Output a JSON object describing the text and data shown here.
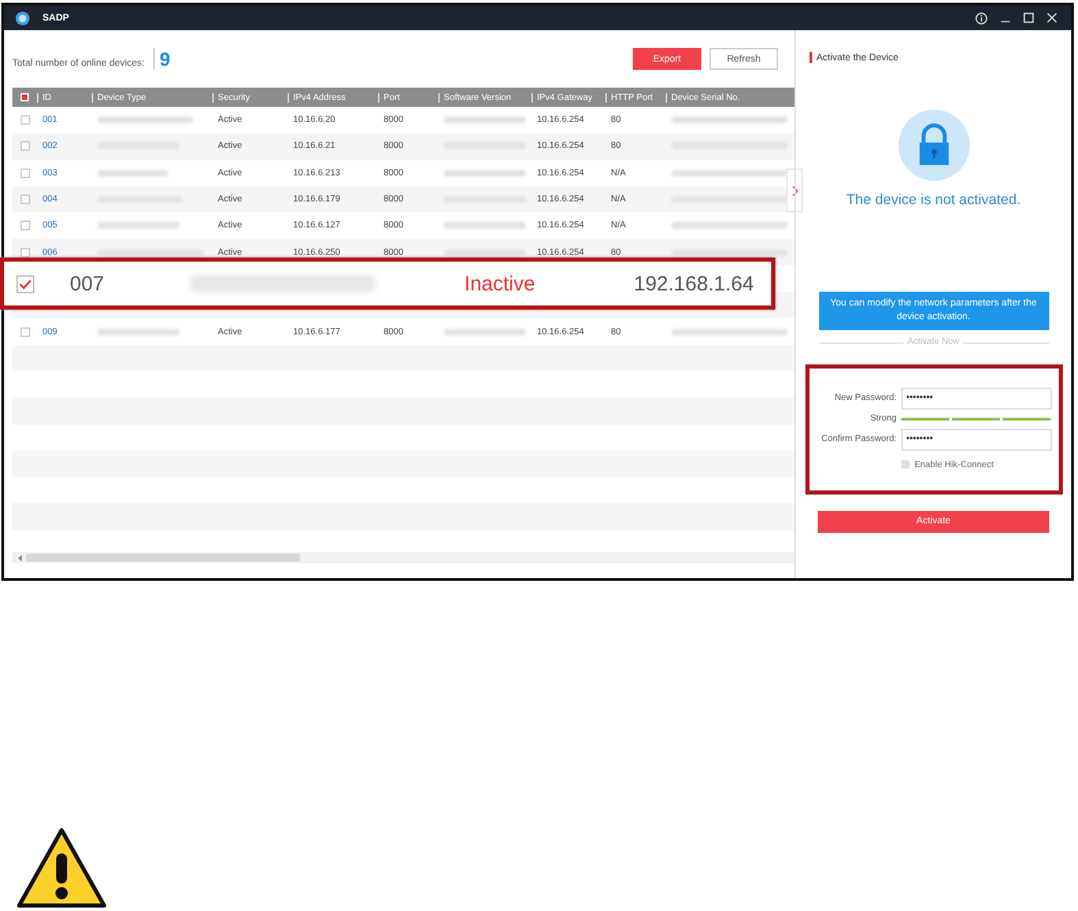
{
  "window": {
    "title": "SADP"
  },
  "summary": {
    "label": "Total number of online devices:",
    "count": "9"
  },
  "toolbar": {
    "buttons": [
      "Export",
      "Refresh"
    ]
  },
  "table": {
    "select_all_partial": true,
    "columns": [
      "ID",
      "Device Type",
      "Security",
      "IPv4 Address",
      "Port",
      "Software Version",
      "IPv4 Gateway",
      "HTTP Port",
      "Device Serial No."
    ],
    "rows": [
      {
        "id": "001",
        "security": "Active",
        "ipv4": "10.16.6.20",
        "port": "8000",
        "gateway": "10.16.6.254",
        "http_port": "80",
        "checked": false
      },
      {
        "id": "002",
        "security": "Active",
        "ipv4": "10.16.6.21",
        "port": "8000",
        "gateway": "10.16.6.254",
        "http_port": "80",
        "checked": false
      },
      {
        "id": "003",
        "security": "Active",
        "ipv4": "10.16.6.213",
        "port": "8000",
        "gateway": "10.16.6.254",
        "http_port": "N/A",
        "checked": false
      },
      {
        "id": "004",
        "security": "Active",
        "ipv4": "10.16.6.179",
        "port": "8000",
        "gateway": "10.16.6.254",
        "http_port": "N/A",
        "checked": false
      },
      {
        "id": "005",
        "security": "Active",
        "ipv4": "10.16.6.127",
        "port": "8000",
        "gateway": "10.16.6.254",
        "http_port": "N/A",
        "checked": false
      },
      {
        "id": "006",
        "security": "Active",
        "ipv4": "10.16.6.250",
        "port": "8000",
        "gateway": "10.16.6.254",
        "http_port": "80",
        "checked": false
      },
      {
        "id": "009",
        "security": "Active",
        "ipv4": "10.16.6.177",
        "port": "8000",
        "gateway": "10.16.6.254",
        "http_port": "80",
        "checked": false
      }
    ]
  },
  "highlighted_row": {
    "id": "007",
    "security": "Inactive",
    "ipv4": "192.168.1.64",
    "checked": true
  },
  "activate_panel": {
    "title": "Activate the Device",
    "status": "The device is not activated.",
    "tooltip": "You can modify the network parameters after the device activation.",
    "divider_label": "Activate Now",
    "new_password": {
      "label": "New Password:",
      "value": "••••••••"
    },
    "strength": {
      "label": "Strong",
      "level": 1
    },
    "confirm_password": {
      "label": "Confirm Password:",
      "value": "••••••••"
    },
    "hik_connect": {
      "label": "Enable Hik-Connect",
      "checked": false
    },
    "button": "Activate"
  }
}
